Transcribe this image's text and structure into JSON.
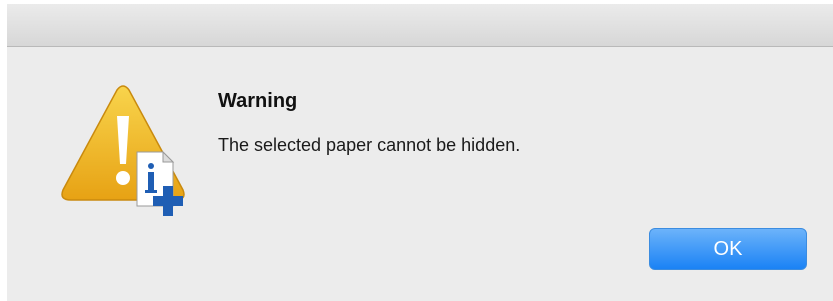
{
  "dialog": {
    "title": "Warning",
    "message": "The selected paper cannot be hidden.",
    "ok_label": "OK",
    "icon": "warning-triangle-icon",
    "badge_icon": "info-add-icon",
    "colors": {
      "background": "#ececec",
      "warning_yellow": "#f2b92a",
      "button_blue": "#1a82f5",
      "badge_blue": "#1f5eb4"
    }
  }
}
